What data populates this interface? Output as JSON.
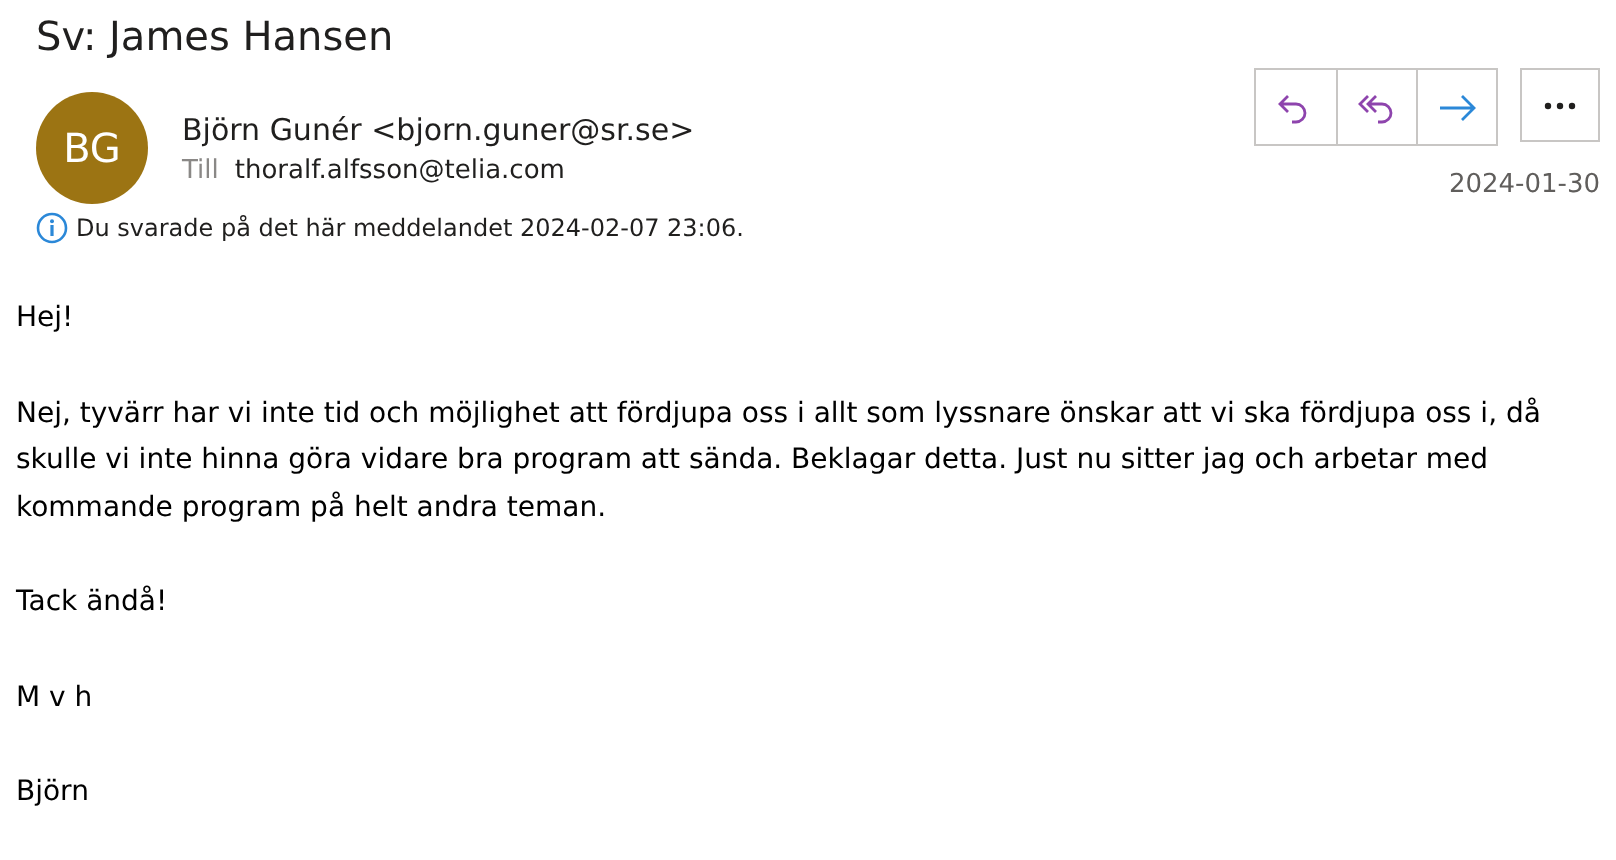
{
  "subject": "Sv: James Hansen",
  "sender": {
    "initials": "BG",
    "color": "#9c7413",
    "name": "Björn Gunér <bjorn.guner@sr.se>"
  },
  "to": {
    "label": "Till",
    "address": "thoralf.alfsson@telia.com"
  },
  "actions": [
    {
      "kind": "reply"
    },
    {
      "kind": "reply-all"
    },
    {
      "kind": "forward"
    },
    {
      "kind": "more"
    }
  ],
  "date": "2024-01-30",
  "info": "Du svarade på det här meddelandet 2024-02-07 23:06.",
  "body": [
    "Hej!",
    "Nej, tyvärr har vi inte tid och möjlighet att fördjupa oss i allt som lyssnare önskar att vi ska fördjupa oss i, då skulle vi inte hinna göra vidare bra program att sända. Beklagar detta. Just nu sitter jag och arbetar med kommande program på helt andra teman.",
    "Tack ändå!",
    "M v h",
    "Björn"
  ]
}
